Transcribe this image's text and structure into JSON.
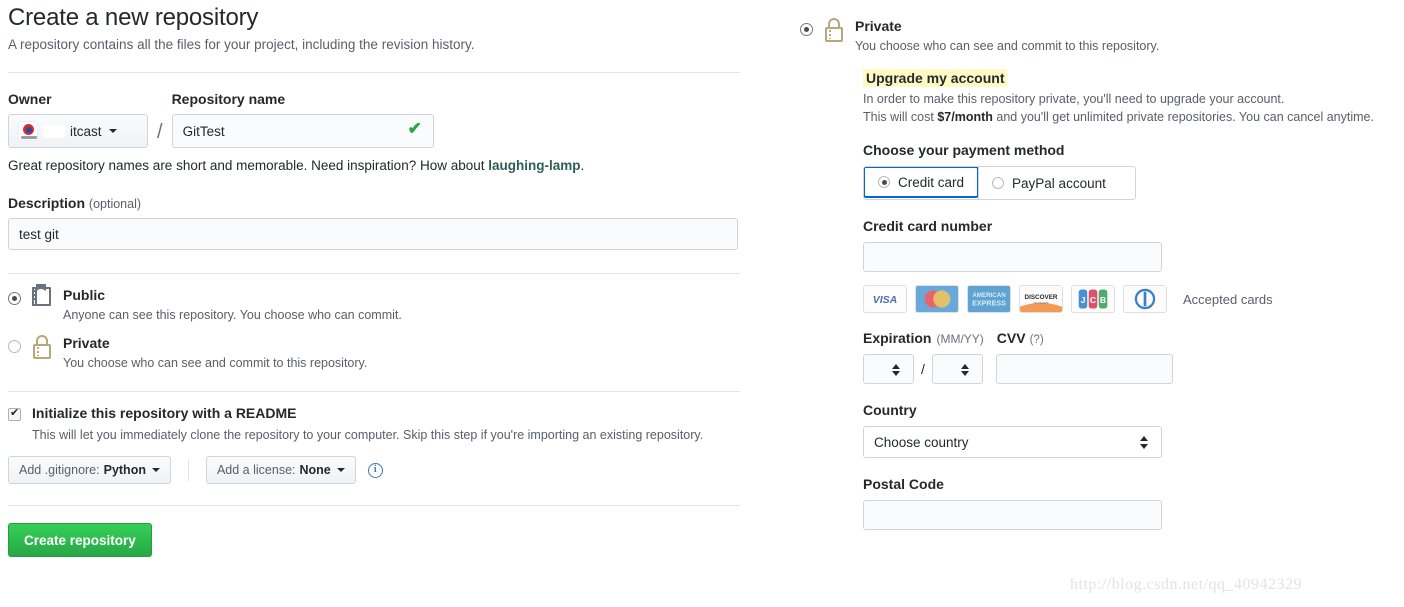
{
  "header": {
    "title": "Create a new repository",
    "subtitle": "A repository contains all the files for your project, including the revision history."
  },
  "form": {
    "owner_label": "Owner",
    "owner_name": "itcast",
    "separator": "/",
    "repo_name_label": "Repository name",
    "repo_name_value": "GitTest",
    "repo_name_valid_icon": "check-icon",
    "hint_prefix": "Great repository names are short and memorable. Need inspiration? How about ",
    "hint_link": "laughing-lamp",
    "hint_suffix": ".",
    "description_label": "Description",
    "description_optional": "(optional)",
    "description_value": "test git"
  },
  "visibility": {
    "public": {
      "title": "Public",
      "desc": "Anyone can see this repository. You choose who can commit.",
      "selected": true,
      "icon": "repo-icon"
    },
    "private": {
      "title": "Private",
      "desc": "You choose who can see and commit to this repository.",
      "selected": false,
      "icon": "lock-icon"
    }
  },
  "readme": {
    "checked": true,
    "title": "Initialize this repository with a README",
    "desc": "This will let you immediately clone the repository to your computer. Skip this step if you're importing an existing repository.",
    "gitignore_prefix": "Add .gitignore: ",
    "gitignore_value": "Python",
    "license_prefix": "Add a license: ",
    "license_value": "None",
    "info_icon": "info-icon"
  },
  "submit": {
    "label": "Create repository",
    "color": "#28a745"
  },
  "right_panel": {
    "private": {
      "title": "Private",
      "desc": "You choose who can see and commit to this repository.",
      "selected": true,
      "icon": "lock-icon"
    },
    "upgrade": {
      "title": "Upgrade my account",
      "highlight_color": "#fff9c4",
      "line1": "In order to make this repository private, you'll need to upgrade your account.",
      "line2_pre": "This will cost ",
      "line2_price": "$7/month",
      "line2_post": " and you'll get unlimited private repositories. You can cancel anytime."
    },
    "payment": {
      "section_label": "Choose your payment method",
      "options": [
        {
          "label": "Credit card",
          "selected": true
        },
        {
          "label": "PayPal account",
          "selected": false
        }
      ],
      "card_number_label": "Credit card number",
      "card_number_value": "",
      "accepted_label": "Accepted cards",
      "cards": [
        {
          "name": "visa-card-icon",
          "text": "VISA"
        },
        {
          "name": "mastercard-card-icon",
          "text": ""
        },
        {
          "name": "amex-card-icon",
          "text": "AMERICAN EXPRESS"
        },
        {
          "name": "discover-card-icon",
          "text": "DISCOVER"
        },
        {
          "name": "jcb-card-icon",
          "text": "JCB"
        },
        {
          "name": "diners-club-card-icon",
          "text": ""
        }
      ],
      "expiration_label": "Expiration",
      "expiration_format": "(MM/YY)",
      "expiration_month": "",
      "expiration_year": "",
      "expiration_separator": "/",
      "cvv_label": "CVV",
      "cvv_help": "(?)",
      "cvv_value": "",
      "country_label": "Country",
      "country_value": "Choose country",
      "postal_label": "Postal Code",
      "postal_value": ""
    }
  },
  "watermark": "http://blog.csdn.net/qq_40942329"
}
